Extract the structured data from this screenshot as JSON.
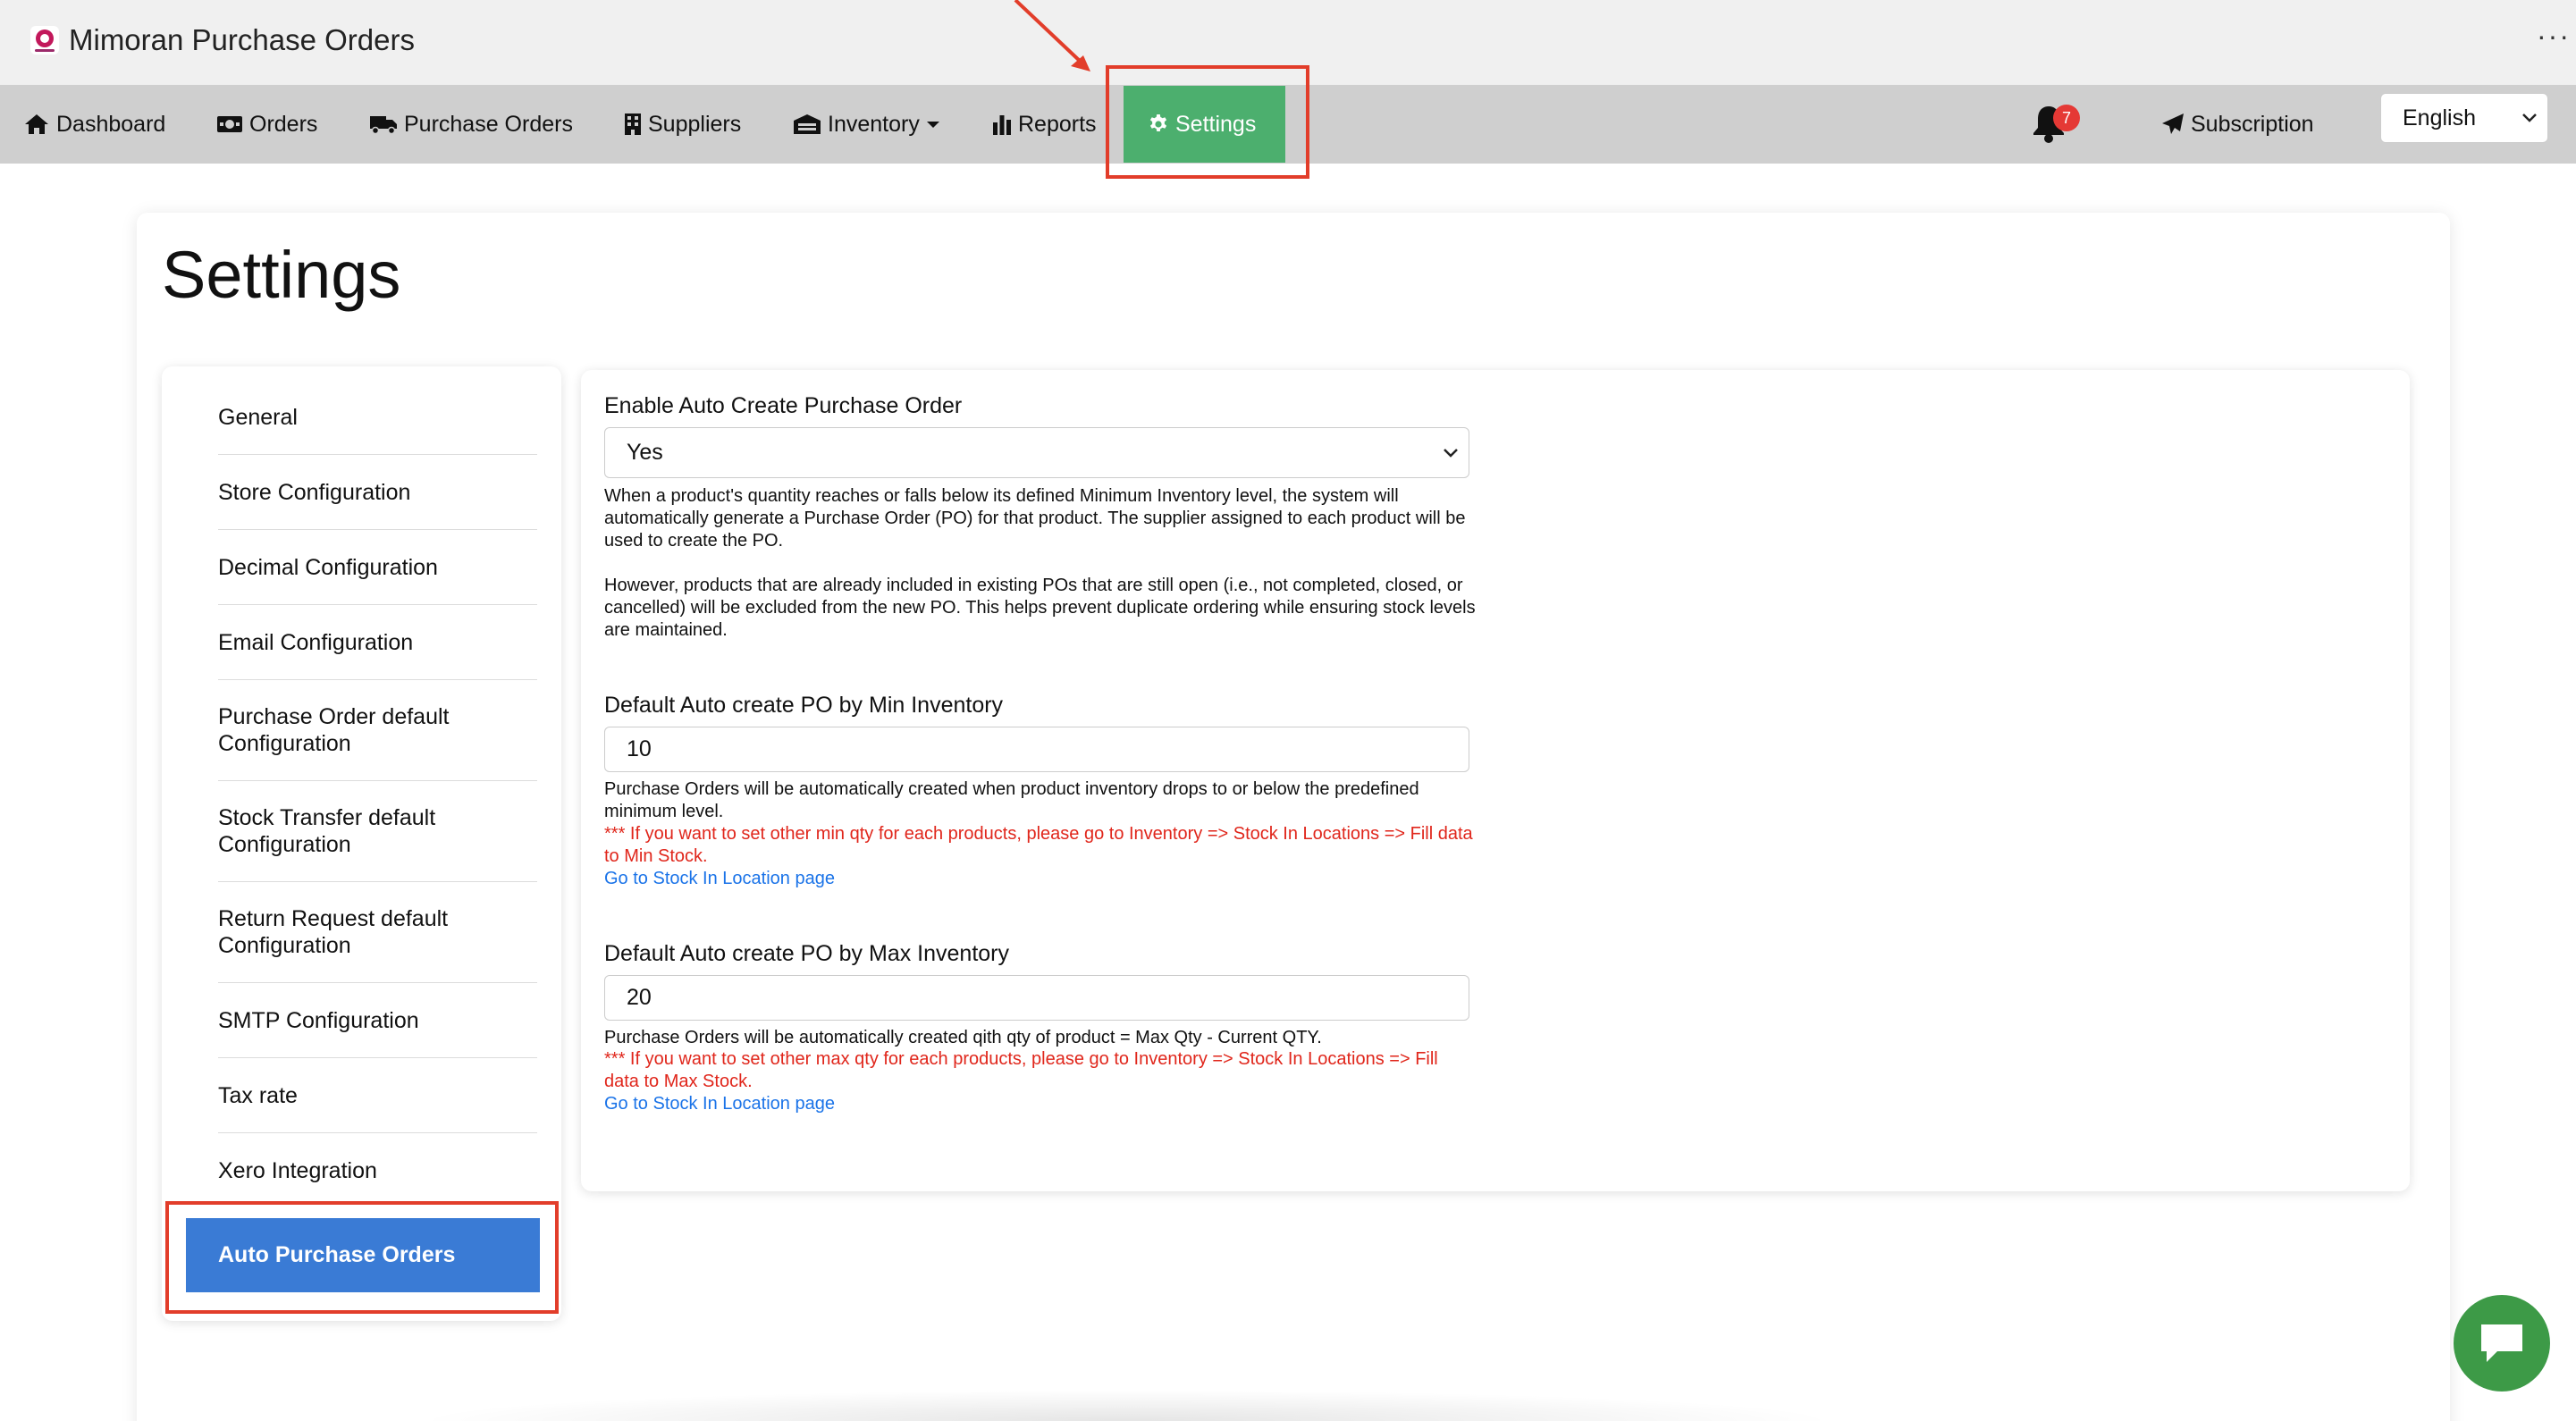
{
  "window": {
    "title": "Mimoran Purchase Orders",
    "more_icon": "more-horizontal-icon"
  },
  "nav": {
    "dashboard": "Dashboard",
    "orders": "Orders",
    "purchase_orders": "Purchase Orders",
    "suppliers": "Suppliers",
    "inventory": "Inventory",
    "reports": "Reports",
    "settings": "Settings",
    "notification_count": "7",
    "subscription": "Subscription",
    "language": "English"
  },
  "page": {
    "title": "Settings"
  },
  "sidebar": {
    "items": [
      {
        "label": "General"
      },
      {
        "label": "Store Configuration"
      },
      {
        "label": "Decimal Configuration"
      },
      {
        "label": "Email Configuration"
      },
      {
        "label": "Purchase Order default Configuration"
      },
      {
        "label": "Stock Transfer default Configuration"
      },
      {
        "label": "Return Request default Configuration"
      },
      {
        "label": "SMTP Configuration"
      },
      {
        "label": "Tax rate"
      },
      {
        "label": "Xero Integration"
      }
    ],
    "active": "Auto Purchase Orders"
  },
  "form": {
    "enable": {
      "label": "Enable Auto Create Purchase Order",
      "value": "Yes",
      "help_1": "When a product's quantity reaches or falls below its defined Minimum Inventory level, the system will automatically generate a Purchase Order (PO) for that product. The supplier assigned to each product will be used to create the PO.",
      "help_2": "However, products that are already included in existing POs that are still open (i.e., not completed, closed, or cancelled) will be excluded from the new PO. This helps prevent duplicate ordering while ensuring stock levels are maintained."
    },
    "min_inventory": {
      "label": "Default Auto create PO by Min Inventory",
      "value": "10",
      "help": "Purchase Orders will be automatically created when product inventory drops to or below the predefined minimum level.",
      "warning": "*** If you want to set other min qty for each products, please go to Inventory => Stock In Locations => Fill data to Min Stock.",
      "link": "Go to Stock In Location page"
    },
    "max_inventory": {
      "label": "Default Auto create PO by Max Inventory",
      "value": "20",
      "help": "Purchase Orders will be automatically created qith qty of product = Max Qty - Current QTY.",
      "warning": "*** If you want to set other max qty for each products, please go to Inventory => Stock In Locations => Fill data to Max Stock.",
      "link": "Go to Stock In Location page"
    }
  },
  "colors": {
    "nav_active": "#4caf6e",
    "sidebar_active": "#3a7bd5",
    "warning_text": "#e0261b",
    "link_text": "#1a73e8",
    "annotation": "#e23d2a",
    "chat_button": "#3d9a47"
  }
}
